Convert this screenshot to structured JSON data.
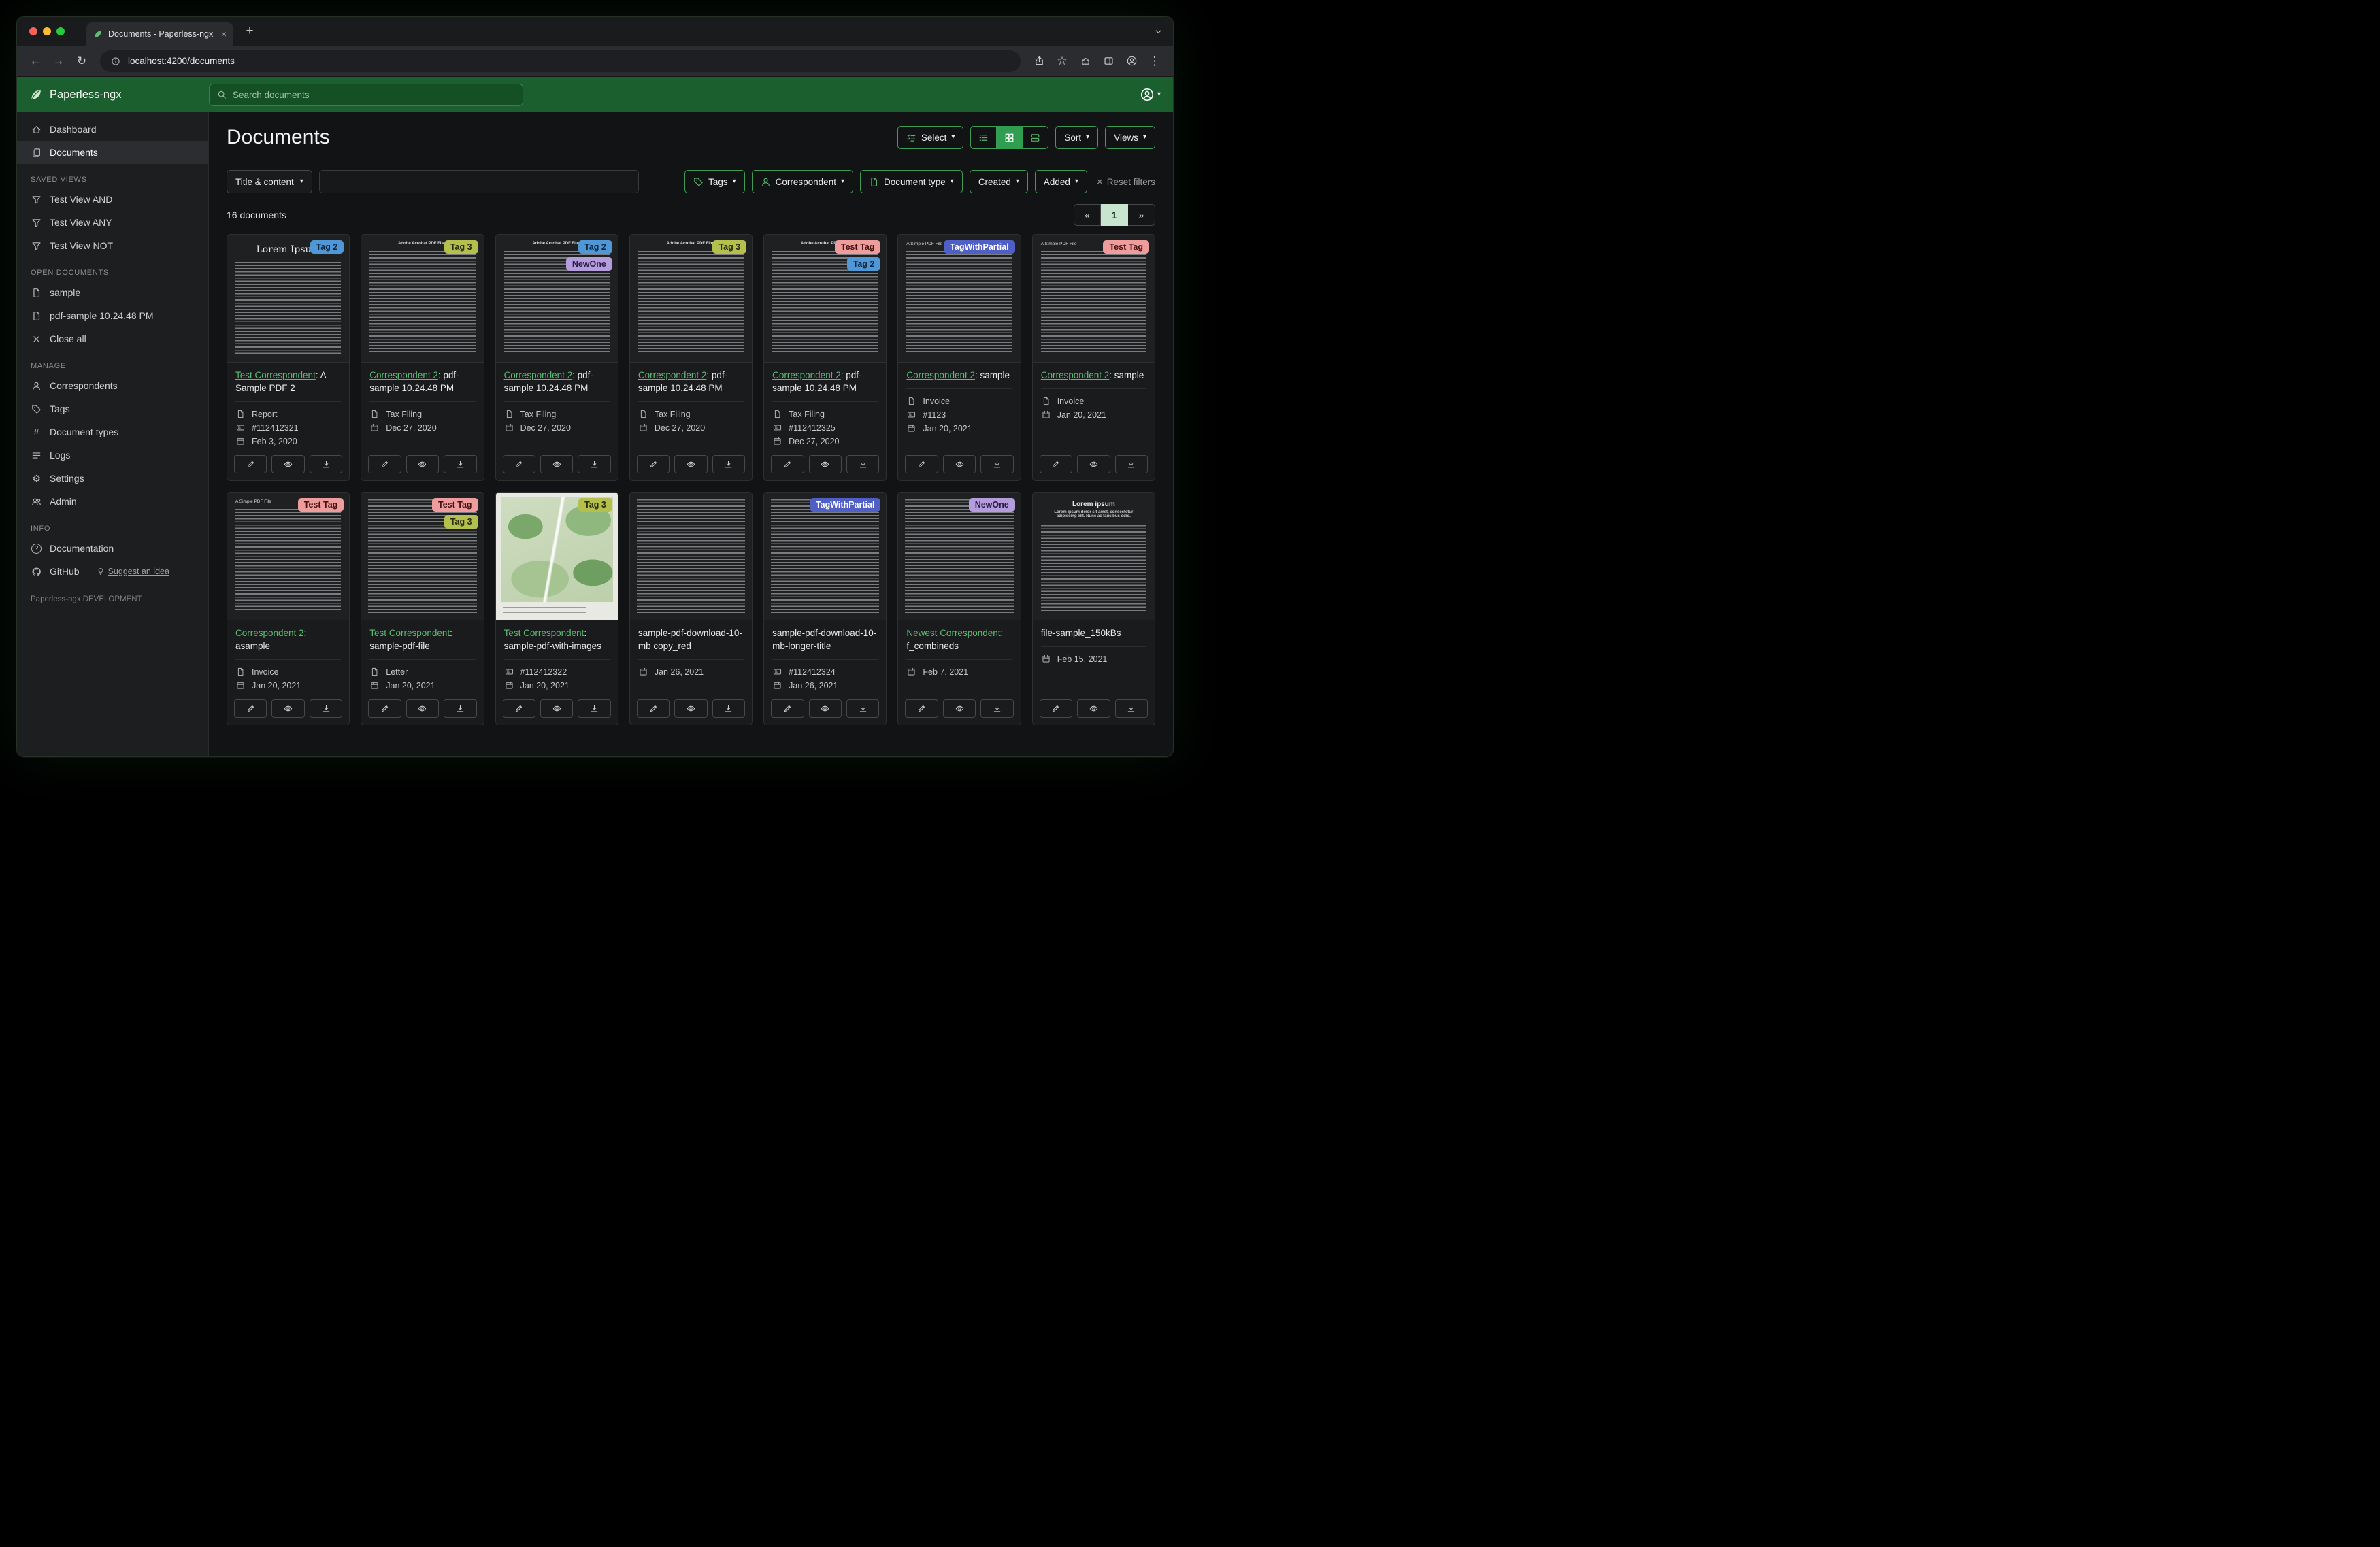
{
  "browser": {
    "tab_title": "Documents - Paperless-ngx",
    "url": "localhost:4200/documents"
  },
  "icons": {
    "back": "←",
    "forward": "→",
    "reload": "↻",
    "menu": "⋮",
    "star": "☆",
    "tab_close": "×",
    "new_tab": "+",
    "caret": "▾",
    "gear": "⚙",
    "hash": "#",
    "question": "?",
    "close": "×",
    "prev": "«",
    "next": "»"
  },
  "app_header": {
    "brand": "Paperless-ngx",
    "search_placeholder": "Search documents"
  },
  "sidebar": {
    "dashboard": "Dashboard",
    "documents": "Documents",
    "saved_views_title": "SAVED VIEWS",
    "saved_views": [
      "Test View AND",
      "Test View ANY",
      "Test View NOT"
    ],
    "open_documents_title": "OPEN DOCUMENTS",
    "open_documents": [
      "sample",
      "pdf-sample 10.24.48 PM"
    ],
    "close_all": "Close all",
    "manage_title": "MANAGE",
    "correspondents": "Correspondents",
    "tags": "Tags",
    "document_types": "Document types",
    "logs": "Logs",
    "settings": "Settings",
    "admin": "Admin",
    "info_title": "INFO",
    "documentation": "Documentation",
    "github": "GitHub",
    "suggest_idea": "Suggest an idea",
    "footer": "Paperless-ngx DEVELOPMENT"
  },
  "page": {
    "title": "Documents",
    "select": "Select",
    "sort": "Sort",
    "views": "Views",
    "count": "16 documents",
    "pagination_page": "1"
  },
  "filters": {
    "field": "Title & content",
    "query": "",
    "tags": "Tags",
    "correspondent": "Correspondent",
    "document_type": "Document type",
    "created": "Created",
    "added": "Added",
    "reset": "Reset filters"
  },
  "colors": {
    "accent_green": "#56b36b",
    "header_green": "#1b5f2f",
    "active_view_bg": "#2f9e50",
    "active_page_bg": "#c7e5cf"
  },
  "tag_palette": {
    "Tag 2": {
      "bg": "#4f97d6",
      "fg": "#0d2740"
    },
    "Tag 3": {
      "bg": "#b4bf4e",
      "fg": "#272b10"
    },
    "NewOne": {
      "bg": "#b49ddc",
      "fg": "#2a1c44"
    },
    "Test Tag": {
      "bg": "#ee9c9c",
      "fg": "#441212"
    },
    "TagWithPartial": {
      "bg": "#4f5fc4",
      "fg": "#ffffff"
    }
  },
  "cards": [
    {
      "tags": [
        "Tag 2"
      ],
      "thumb": {
        "kind": "serif",
        "heading": "Lorem Ipsum"
      },
      "correspondent": "Test Correspondent",
      "title_rest": ": A Sample PDF 2",
      "type": "Report",
      "asn": "#112412321",
      "date": "Feb 3, 2020"
    },
    {
      "tags": [
        "Tag 3"
      ],
      "thumb": {
        "kind": "acrobat",
        "heading": "Adobe Acrobat PDF Files"
      },
      "correspondent": "Correspondent 2",
      "title_rest": ": pdf-sample 10.24.48 PM",
      "type": "Tax Filing",
      "date": "Dec 27, 2020"
    },
    {
      "tags": [
        "Tag 2",
        "NewOne"
      ],
      "thumb": {
        "kind": "acrobat",
        "heading": "Adobe Acrobat PDF Files"
      },
      "correspondent": "Correspondent 2",
      "title_rest": ": pdf-sample 10.24.48 PM",
      "type": "Tax Filing",
      "date": "Dec 27, 2020"
    },
    {
      "tags": [
        "Tag 3"
      ],
      "thumb": {
        "kind": "acrobat",
        "heading": "Adobe Acrobat PDF Files"
      },
      "correspondent": "Correspondent 2",
      "title_rest": ": pdf-sample 10.24.48 PM",
      "type": "Tax Filing",
      "date": "Dec 27, 2020"
    },
    {
      "tags": [
        "Test Tag",
        "Tag 2"
      ],
      "thumb": {
        "kind": "acrobat",
        "heading": "Adobe Acrobat PDF Files"
      },
      "correspondent": "Correspondent 2",
      "title_rest": ": pdf-sample 10.24.48 PM",
      "type": "Tax Filing",
      "asn": "#112412325",
      "date": "Dec 27, 2020"
    },
    {
      "tags": [
        "TagWithPartial"
      ],
      "thumb": {
        "kind": "simple",
        "heading": "A Simple PDF File"
      },
      "correspondent": "Correspondent 2",
      "title_rest": ": sample",
      "type": "Invoice",
      "asn": "#1123",
      "date": "Jan 20, 2021"
    },
    {
      "tags": [
        "Test Tag"
      ],
      "thumb": {
        "kind": "simple",
        "heading": "A Simple PDF File"
      },
      "correspondent": "Correspondent 2",
      "title_rest": ": sample",
      "type": "Invoice",
      "date": "Jan 20, 2021"
    },
    {
      "tags": [
        "Test Tag"
      ],
      "thumb": {
        "kind": "simple",
        "heading": "A Simple PDF File"
      },
      "correspondent": "Correspondent 2",
      "title_rest": ": asample",
      "type": "Invoice",
      "date": "Jan 20, 2021"
    },
    {
      "tags": [
        "Test Tag",
        "Tag 3"
      ],
      "thumb": {
        "kind": "dense"
      },
      "correspondent": "Test Correspondent",
      "title_rest": ": sample-pdf-file",
      "type": "Letter",
      "date": "Jan 20, 2021"
    },
    {
      "tags": [
        "Tag 3"
      ],
      "thumb": {
        "kind": "map"
      },
      "correspondent": "Test Correspondent",
      "title_rest": ": sample-pdf-with-images",
      "asn": "#112412322",
      "date": "Jan 20, 2021"
    },
    {
      "tags": [],
      "thumb": {
        "kind": "dense"
      },
      "correspondent": null,
      "title_rest": "sample-pdf-download-10-mb copy_red",
      "date": "Jan 26, 2021"
    },
    {
      "tags": [
        "TagWithPartial"
      ],
      "thumb": {
        "kind": "dense"
      },
      "correspondent": null,
      "title_rest": "sample-pdf-download-10-mb-longer-title",
      "asn": "#112412324",
      "date": "Jan 26, 2021"
    },
    {
      "tags": [
        "NewOne"
      ],
      "thumb": {
        "kind": "dense"
      },
      "correspondent": "Newest Correspondent",
      "title_rest": ": f_combineds",
      "date": "Feb 7, 2021"
    },
    {
      "tags": [],
      "thumb": {
        "kind": "centered",
        "heading": "Lorem ipsum",
        "sub": "Lorem ipsum dolor sit amet, consectetur adipiscing elit. Nunc ac faucibus odio."
      },
      "correspondent": null,
      "title_rest": "file-sample_150kBs",
      "date": "Feb 15, 2021"
    }
  ]
}
